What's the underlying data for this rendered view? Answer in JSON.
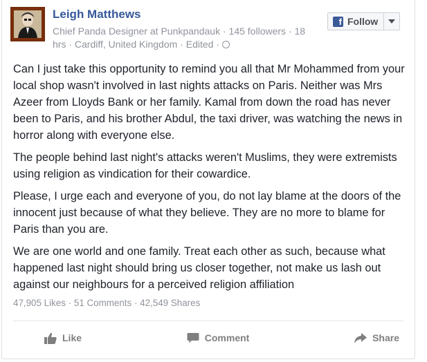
{
  "post": {
    "author": "Leigh Matthews",
    "meta": {
      "title": "Chief Panda Designer",
      "at": "at",
      "org": "Punkpandauk",
      "followers": "145 followers",
      "time": "18 hrs",
      "location": "Cardiff, United Kingdom",
      "edited": "Edited",
      "sep": "·"
    },
    "follow_label": "Follow",
    "paragraphs": [
      "Can I just take this opportunity to remind you all that Mr Mohammed from your local shop wasn't involved in last nights attacks on Paris. Neither was Mrs Azeer from Lloyds Bank or her family. Kamal from down the road has never been to Paris, and his brother Abdul, the taxi driver, was watching the news in horror along with everyone else.",
      "The people behind last night's attacks weren't Muslims, they were extremists using religion as vindication for their cowardice.",
      "Please, I urge each and everyone of you, do not lay blame at the doors of the innocent just because of what they believe. They are no more to blame for Paris than you are.",
      "We are one world and one family. Treat each other as such, because what happened last night should bring us closer together, not make us lash out against our neighbours for a perceived religion affiliation"
    ],
    "stats": {
      "likes": "47,905 Likes",
      "comments": "51 Comments",
      "shares": "42,549 Shares",
      "sep": "·"
    },
    "actions": {
      "like": "Like",
      "comment": "Comment",
      "share": "Share"
    }
  },
  "colors": {
    "name": "#365899",
    "meta": "#90949c",
    "fb_blue": "#3b5998",
    "action": "#7f7f7f"
  },
  "icons": [
    "avatar-photo",
    "facebook-f-icon",
    "caret-down-icon",
    "globe-icon",
    "thumbs-up-icon",
    "comment-icon",
    "share-arrow-icon"
  ]
}
